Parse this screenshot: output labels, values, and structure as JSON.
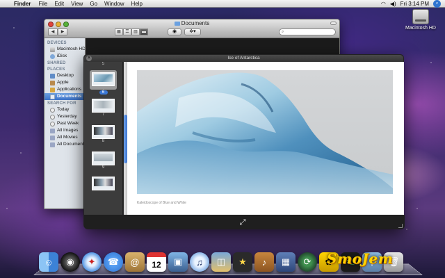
{
  "menubar": {
    "apple": "",
    "app_name": "Finder",
    "items": [
      "File",
      "Edit",
      "View",
      "Go",
      "Window",
      "Help"
    ],
    "clock": "Fri 3:14 PM"
  },
  "desktop": {
    "hd_label": "Macintosh HD"
  },
  "finder": {
    "title": "Documents",
    "sidebar": {
      "devices_header": "DEVICES",
      "devices": [
        "Macintosh HD",
        "iDisk"
      ],
      "shared_header": "SHARED",
      "places_header": "PLACES",
      "places": [
        "Desktop",
        "Apple",
        "Applications",
        "Documents"
      ],
      "search_header": "SEARCH FOR",
      "search_items": [
        "Today",
        "Yesterday",
        "Past Week",
        "All Images",
        "All Movies",
        "All Documents"
      ]
    }
  },
  "quicklook": {
    "title": "Ice of Antarctica",
    "thumb_labels": [
      "5",
      "6",
      "7",
      "8",
      "9"
    ],
    "selected_page": "6",
    "caption": "Kaleidoscope of Blue and White"
  },
  "watermark": "SmoJem",
  "dock": {
    "items": [
      {
        "name": "finder",
        "glyph": "☺"
      },
      {
        "name": "dashboard",
        "glyph": "◉"
      },
      {
        "name": "safari",
        "glyph": "✦"
      },
      {
        "name": "ichat",
        "glyph": "☎"
      },
      {
        "name": "address-book",
        "glyph": "@"
      },
      {
        "name": "ical",
        "glyph": "12"
      },
      {
        "name": "iphoto",
        "glyph": "▣"
      },
      {
        "name": "itunes",
        "glyph": "♫"
      },
      {
        "name": "preview",
        "glyph": "◫"
      },
      {
        "name": "imovie",
        "glyph": "★"
      },
      {
        "name": "garageband",
        "glyph": "♪"
      },
      {
        "name": "spaces",
        "glyph": "▦"
      },
      {
        "name": "time-machine",
        "glyph": "⟳"
      },
      {
        "name": "bee",
        "glyph": "✿"
      },
      {
        "name": "terminal",
        "glyph": ">_"
      },
      {
        "name": "downloads",
        "glyph": "↓"
      },
      {
        "name": "trash",
        "glyph": "🗑"
      }
    ]
  }
}
